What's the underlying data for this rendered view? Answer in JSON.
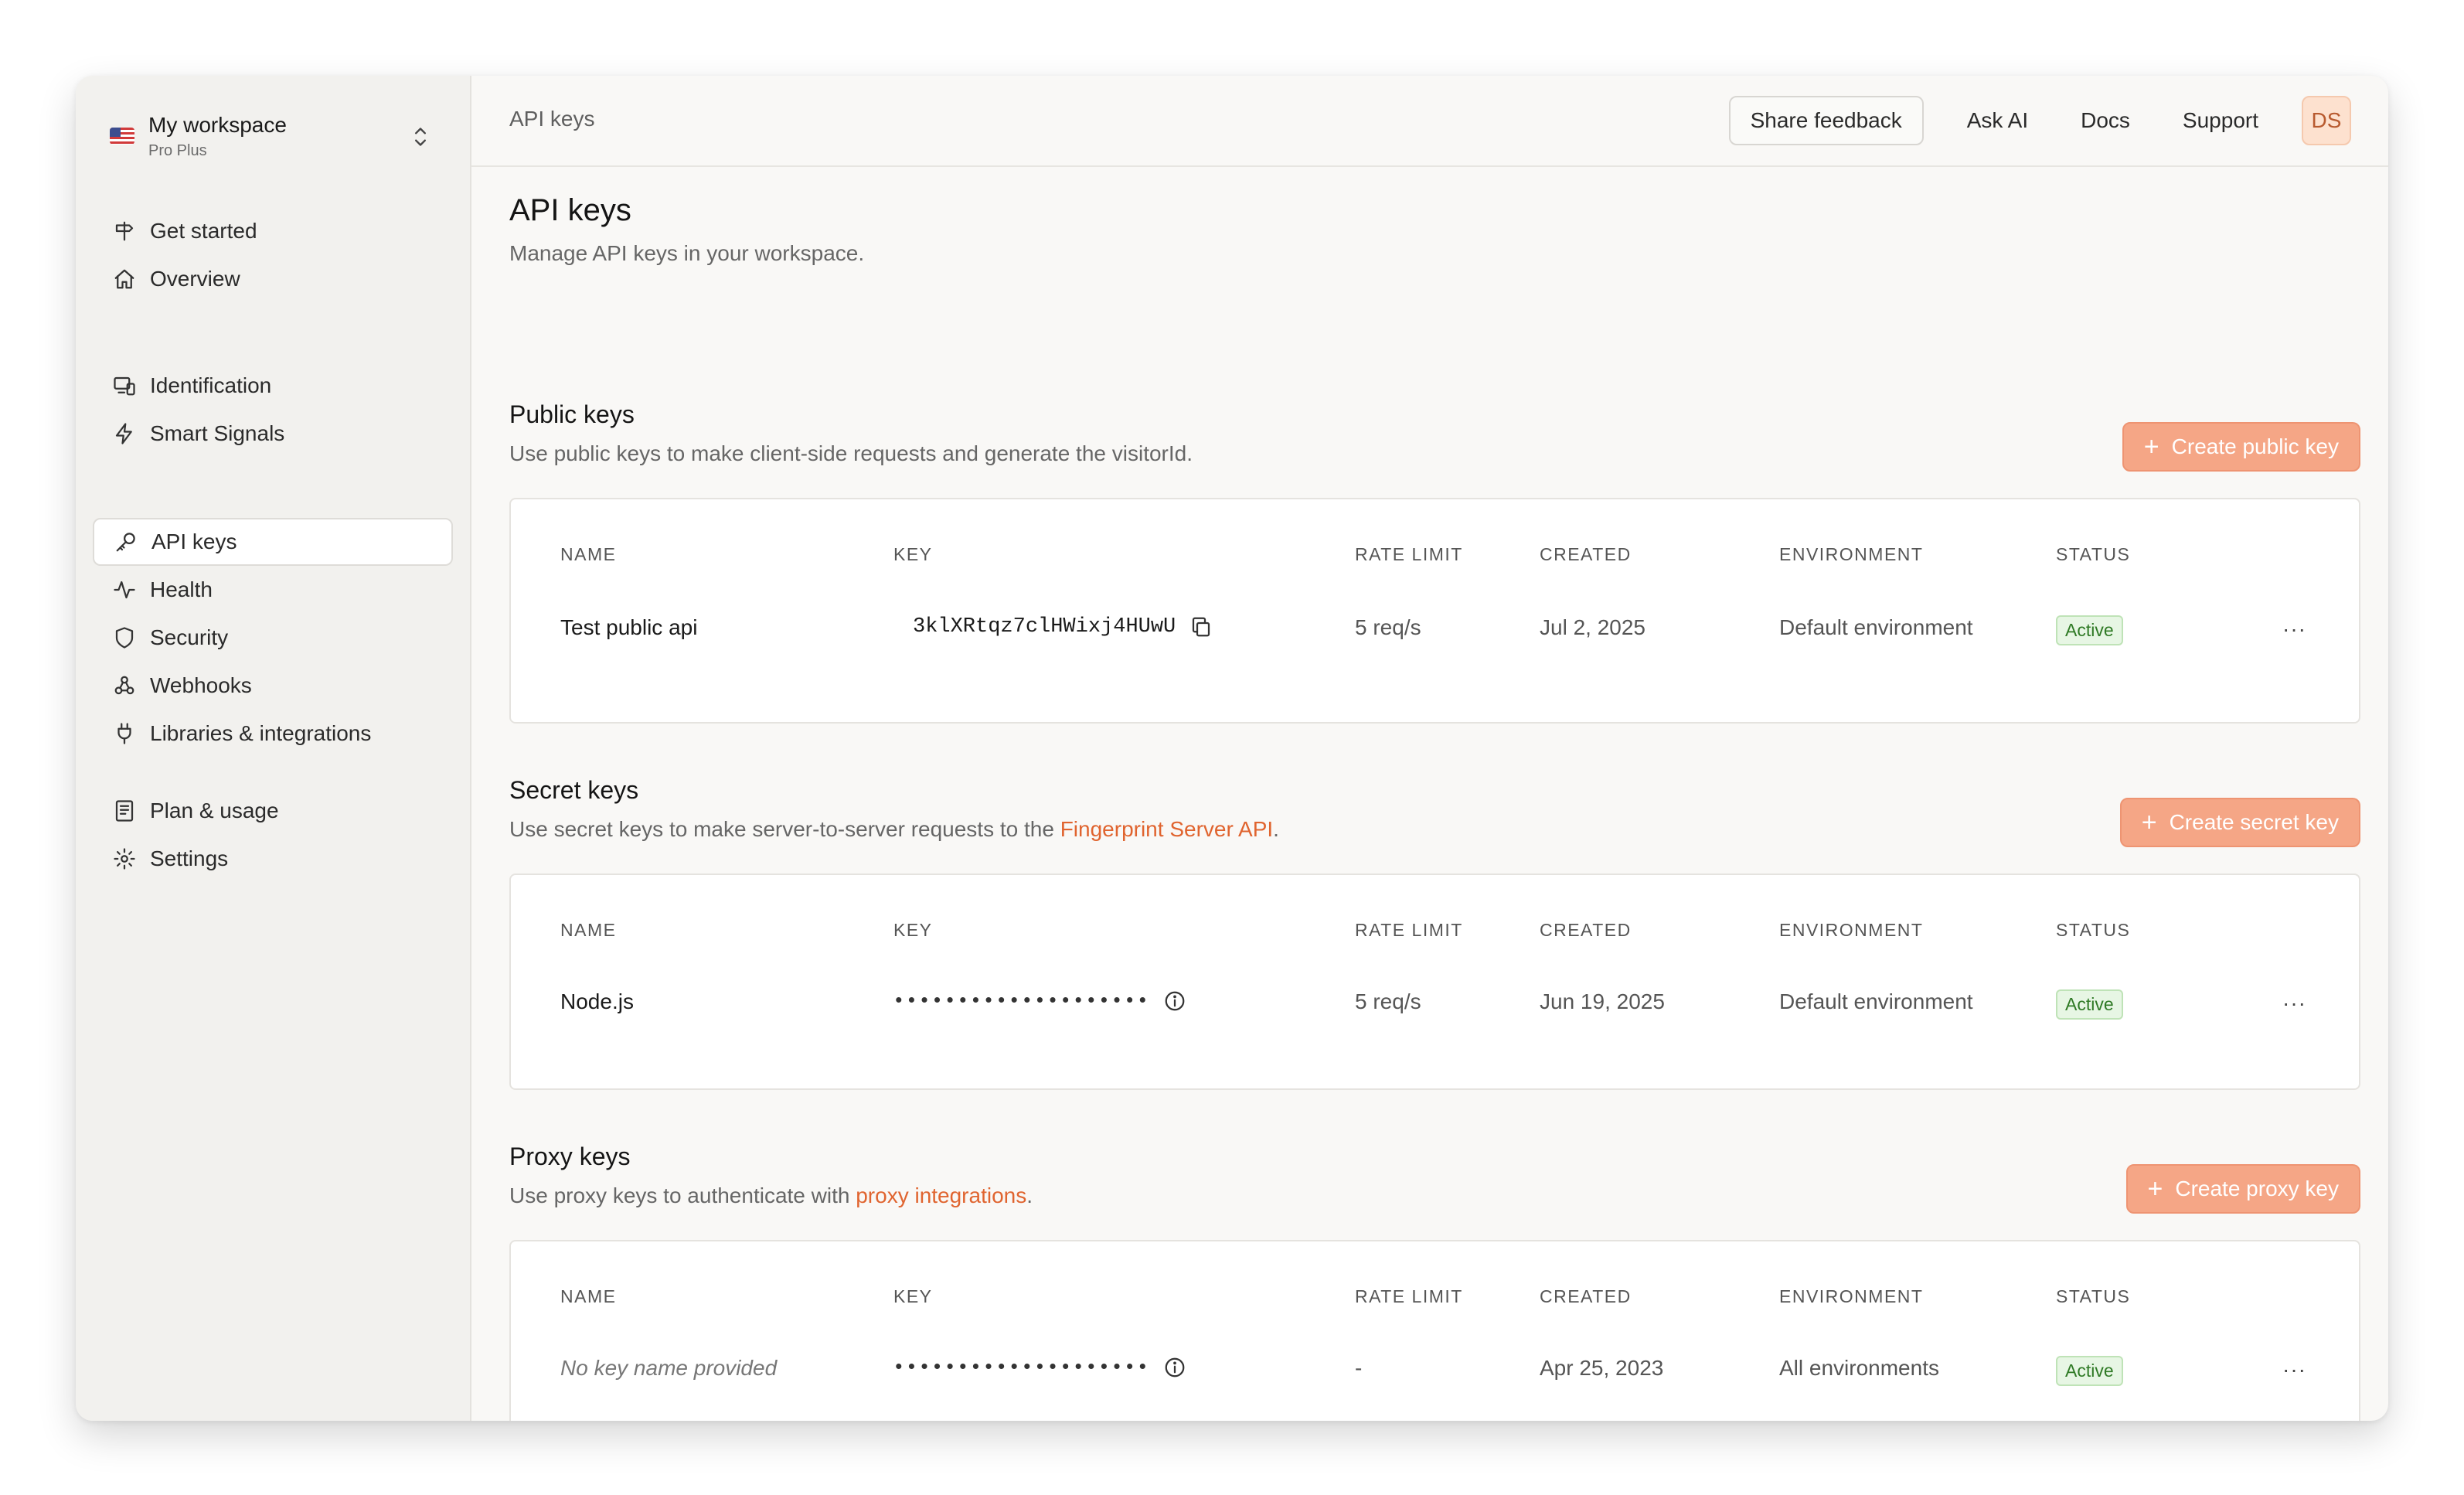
{
  "workspace": {
    "name": "My workspace",
    "plan": "Pro Plus"
  },
  "sidebar": {
    "groups": [
      [
        {
          "label": "Get started",
          "icon": "signpost-icon"
        },
        {
          "label": "Overview",
          "icon": "home-icon"
        }
      ],
      [
        {
          "label": "Identification",
          "icon": "devices-icon"
        },
        {
          "label": "Smart Signals",
          "icon": "lightning-icon"
        }
      ],
      [
        {
          "label": "API keys",
          "icon": "key-icon",
          "active": true
        },
        {
          "label": "Health",
          "icon": "activity-icon"
        },
        {
          "label": "Security",
          "icon": "shield-icon"
        },
        {
          "label": "Webhooks",
          "icon": "webhook-icon"
        },
        {
          "label": "Libraries & integrations",
          "icon": "plug-icon"
        }
      ],
      [
        {
          "label": "Plan & usage",
          "icon": "receipt-icon"
        },
        {
          "label": "Settings",
          "icon": "gear-icon"
        }
      ]
    ]
  },
  "header": {
    "breadcrumb": "API keys",
    "share_feedback": "Share feedback",
    "ask_ai": "Ask AI",
    "docs": "Docs",
    "support": "Support",
    "avatar_initials": "DS"
  },
  "page": {
    "title": "API keys",
    "subtitle": "Manage API keys in your workspace."
  },
  "columns": [
    "NAME",
    "KEY",
    "RATE LIMIT",
    "CREATED",
    "ENVIRONMENT",
    "STATUS"
  ],
  "public_keys": {
    "title": "Public keys",
    "desc": "Use public keys to make client-side requests and generate the visitorId.",
    "create_label": "Create public key",
    "row": {
      "name": "Test public api",
      "key": "3klXRtqz7clHWixj4HUwU",
      "rate_limit": "5 req/s",
      "created": "Jul 2, 2025",
      "environment": "Default environment",
      "status": "Active"
    }
  },
  "secret_keys": {
    "title": "Secret keys",
    "desc_prefix": "Use secret keys to make server-to-server requests to the ",
    "desc_link": "Fingerprint Server API",
    "desc_suffix": ".",
    "create_label": "Create secret key",
    "row": {
      "name": "Node.js",
      "key": "••••••••••••••••••••",
      "rate_limit": "5 req/s",
      "created": "Jun 19, 2025",
      "environment": "Default environment",
      "status": "Active"
    }
  },
  "proxy_keys": {
    "title": "Proxy keys",
    "desc_prefix": "Use proxy keys to authenticate with ",
    "desc_link": "proxy integrations",
    "desc_suffix": ".",
    "create_label": "Create proxy key",
    "row": {
      "name": "No key name provided",
      "key": "••••••••••••••••••••",
      "rate_limit": "-",
      "created": "Apr 25, 2023",
      "environment": "All environments",
      "status": "Active"
    }
  },
  "row_menu": "···",
  "colors": {
    "accent": "#e0642f",
    "create_button": "#f5a686",
    "active_badge": "#e7f6e4"
  }
}
